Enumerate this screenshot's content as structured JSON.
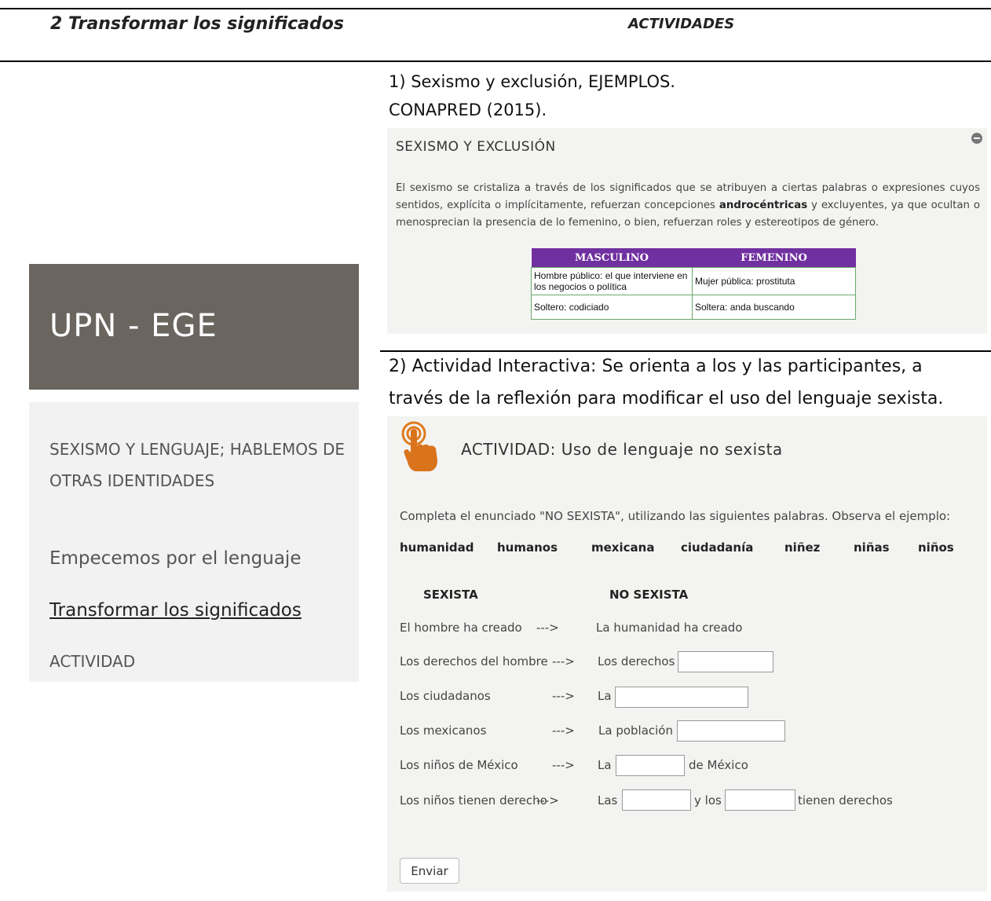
{
  "header": {
    "left_title": "2 Transformar los significados",
    "right_title": "ACTIVIDADES"
  },
  "sidebar": {
    "brand": "UPN - EGE",
    "items": [
      {
        "label": "SEXISMO Y LENGUAJE; HABLEMOS DE OTRAS IDENTIDADES"
      },
      {
        "label": "Empecemos por el lenguaje"
      },
      {
        "label": "Transformar los significados",
        "active": true
      },
      {
        "label": "ACTIVIDAD"
      }
    ]
  },
  "section1": {
    "caption_line1": "1) Sexismo y exclusión, EJEMPLOS.",
    "caption_line2": "CONAPRED (2015).",
    "panel_title": "SEXISMO Y EXCLUSIÓN",
    "text_before": "El sexismo se cristaliza a través de los significados que se atribuyen a ciertas palabras o expresiones cuyos sentidos, explícita o implícitamente, refuerzan concepciones ",
    "text_bold": "androcéntricas",
    "text_after": " y excluyentes, ya que ocultan o menosprecian la presencia de lo femenino, o bien, refuerzan roles y estereotipos de género.",
    "table": {
      "headers": [
        "MASCULINO",
        "FEMENINO"
      ],
      "rows": [
        [
          "Hombre público: el que interviene en los negocios o política",
          "Mujer pública: prostituta"
        ],
        [
          "Soltero: codiciado",
          "Soltera: anda buscando"
        ]
      ],
      "header_color": "#7030a0"
    }
  },
  "section2": {
    "caption_line1": "2) Actividad Interactiva: Se orienta a los y las participantes, a",
    "caption_line2": "través de la reflexión para modificar el uso del lenguaje sexista.",
    "icon": "hand-pointer-icon",
    "icon_color": "#e07a1f",
    "panel_title": "ACTIVIDAD: Uso de lenguaje no sexista",
    "instructions": "Completa el enunciado \"NO SEXISTA\", utilizando las siguientes palabras. Observa el ejemplo:",
    "words": [
      "humanidad",
      "humanos",
      "mexicana",
      "ciudadanía",
      "niñez",
      "niñas",
      "niños"
    ],
    "col_sexista": "SEXISTA",
    "col_no_sexista": "NO SEXISTA",
    "rows": [
      {
        "sexista": "El hombre ha creado",
        "arrow": "--->",
        "no_sexista": "La humanidad ha creado"
      },
      {
        "sexista": "Los derechos del hombre",
        "arrow": "--->",
        "prefix": "Los derechos",
        "value": ""
      },
      {
        "sexista": "Los ciudadanos",
        "arrow": "--->",
        "prefix": "La",
        "value": ""
      },
      {
        "sexista": "Los mexicanos",
        "arrow": "--->",
        "prefix": "La población",
        "value": ""
      },
      {
        "sexista": "Los niños de México",
        "arrow": "--->",
        "prefix": "La",
        "value": "",
        "suffix": "de México"
      },
      {
        "sexista": "Los niños tienen derecho",
        "arrow": "--->",
        "prefix": "Las",
        "value": "",
        "middle": "y los",
        "value2": "",
        "suffix": "tienen derechos"
      }
    ],
    "submit_label": "Enviar"
  }
}
